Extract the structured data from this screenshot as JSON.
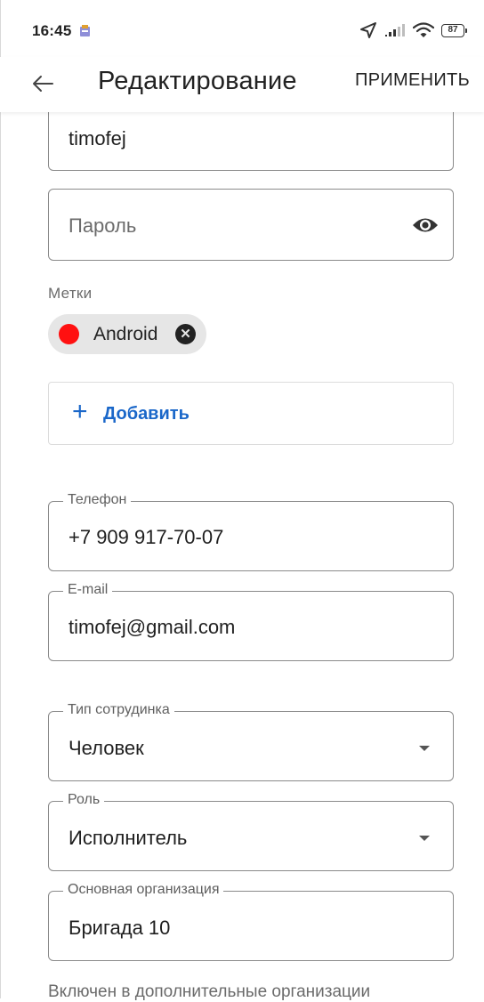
{
  "status_bar": {
    "time": "16:45",
    "battery": "87"
  },
  "app_bar": {
    "title": "Редактирование",
    "apply_label": "ПРИМЕНИТЬ"
  },
  "form": {
    "login_value": "timofej",
    "password_placeholder": "Пароль",
    "tags": {
      "label": "Метки",
      "items": [
        {
          "label": "Android",
          "color": "#ff1010"
        }
      ],
      "add_label": "Добавить"
    },
    "phone": {
      "label": "Телефон",
      "value": "+7 909 917-70-07"
    },
    "email": {
      "label": "E-mail",
      "value": "timofej@gmail.com"
    },
    "employee_type": {
      "label": "Тип сотрудинка",
      "value": "Человек"
    },
    "role": {
      "label": "Роль",
      "value": "Исполнитель"
    },
    "organization": {
      "label": "Основная организация",
      "value": "Бригада 10"
    },
    "extra_orgs_label": "Включен в дополнительные организации"
  },
  "accent_color": "#1a67c9"
}
